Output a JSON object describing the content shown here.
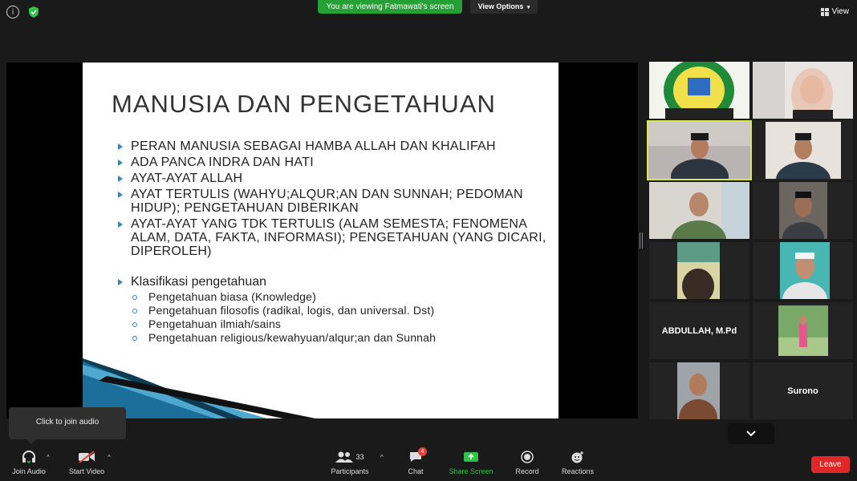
{
  "top_bar": {
    "info_icon": "info-icon",
    "security_icon": "shield-check-icon",
    "viewing_banner": "You are viewing Fatmawati's screen",
    "view_options": "View Options",
    "view_label": "View"
  },
  "slide": {
    "title": "MANUSIA DAN PENGETAHUAN",
    "bullets": [
      "PERAN MANUSIA SEBAGAI HAMBA ALLAH DAN KHALIFAH",
      "ADA PANCA INDRA DAN HATI",
      "AYAT-AYAT ALLAH",
      "AYAT TERTULIS (WAHYU;ALQUR;AN DAN SUNNAH; PEDOMAN HIDUP); PENGETAHUAN DIBERIKAN",
      "AYAT-AYAT YANG TDK TERTULIS (ALAM SEMESTA; FENOMENA ALAM, DATA, FAKTA, INFORMASI); PENGETAHUAN (YANG DICARI, DIPEROLEH)"
    ],
    "klasifikasi_heading": "Klasifikasi pengetahuan",
    "klasifikasi_items": [
      "Pengetahuan biasa (Knowledge)",
      "Pengetahuan filosofis (radikal, logis, dan universal. Dst)",
      "Pengetahuan ilmiah/sains",
      "Pengetahuan religious/kewahyuan/alqur;an dan Sunnah"
    ]
  },
  "gallery": {
    "name_tiles": [
      "ABDULLAH, M.Pd",
      "Surono"
    ]
  },
  "tooltip": {
    "text": "Click to join audio"
  },
  "toolbar": {
    "join_audio": "Join Audio",
    "start_video": "Start Video",
    "participants": "Participants",
    "participants_count": "33",
    "chat": "Chat",
    "chat_badge": "4",
    "share_screen": "Share Screen",
    "record": "Record",
    "reactions": "Reactions",
    "leave": "Leave"
  },
  "colors": {
    "banner_green": "#25a035",
    "active_speaker": "#d7e84a",
    "leave_red": "#e02828",
    "share_green": "#2fc14a"
  }
}
